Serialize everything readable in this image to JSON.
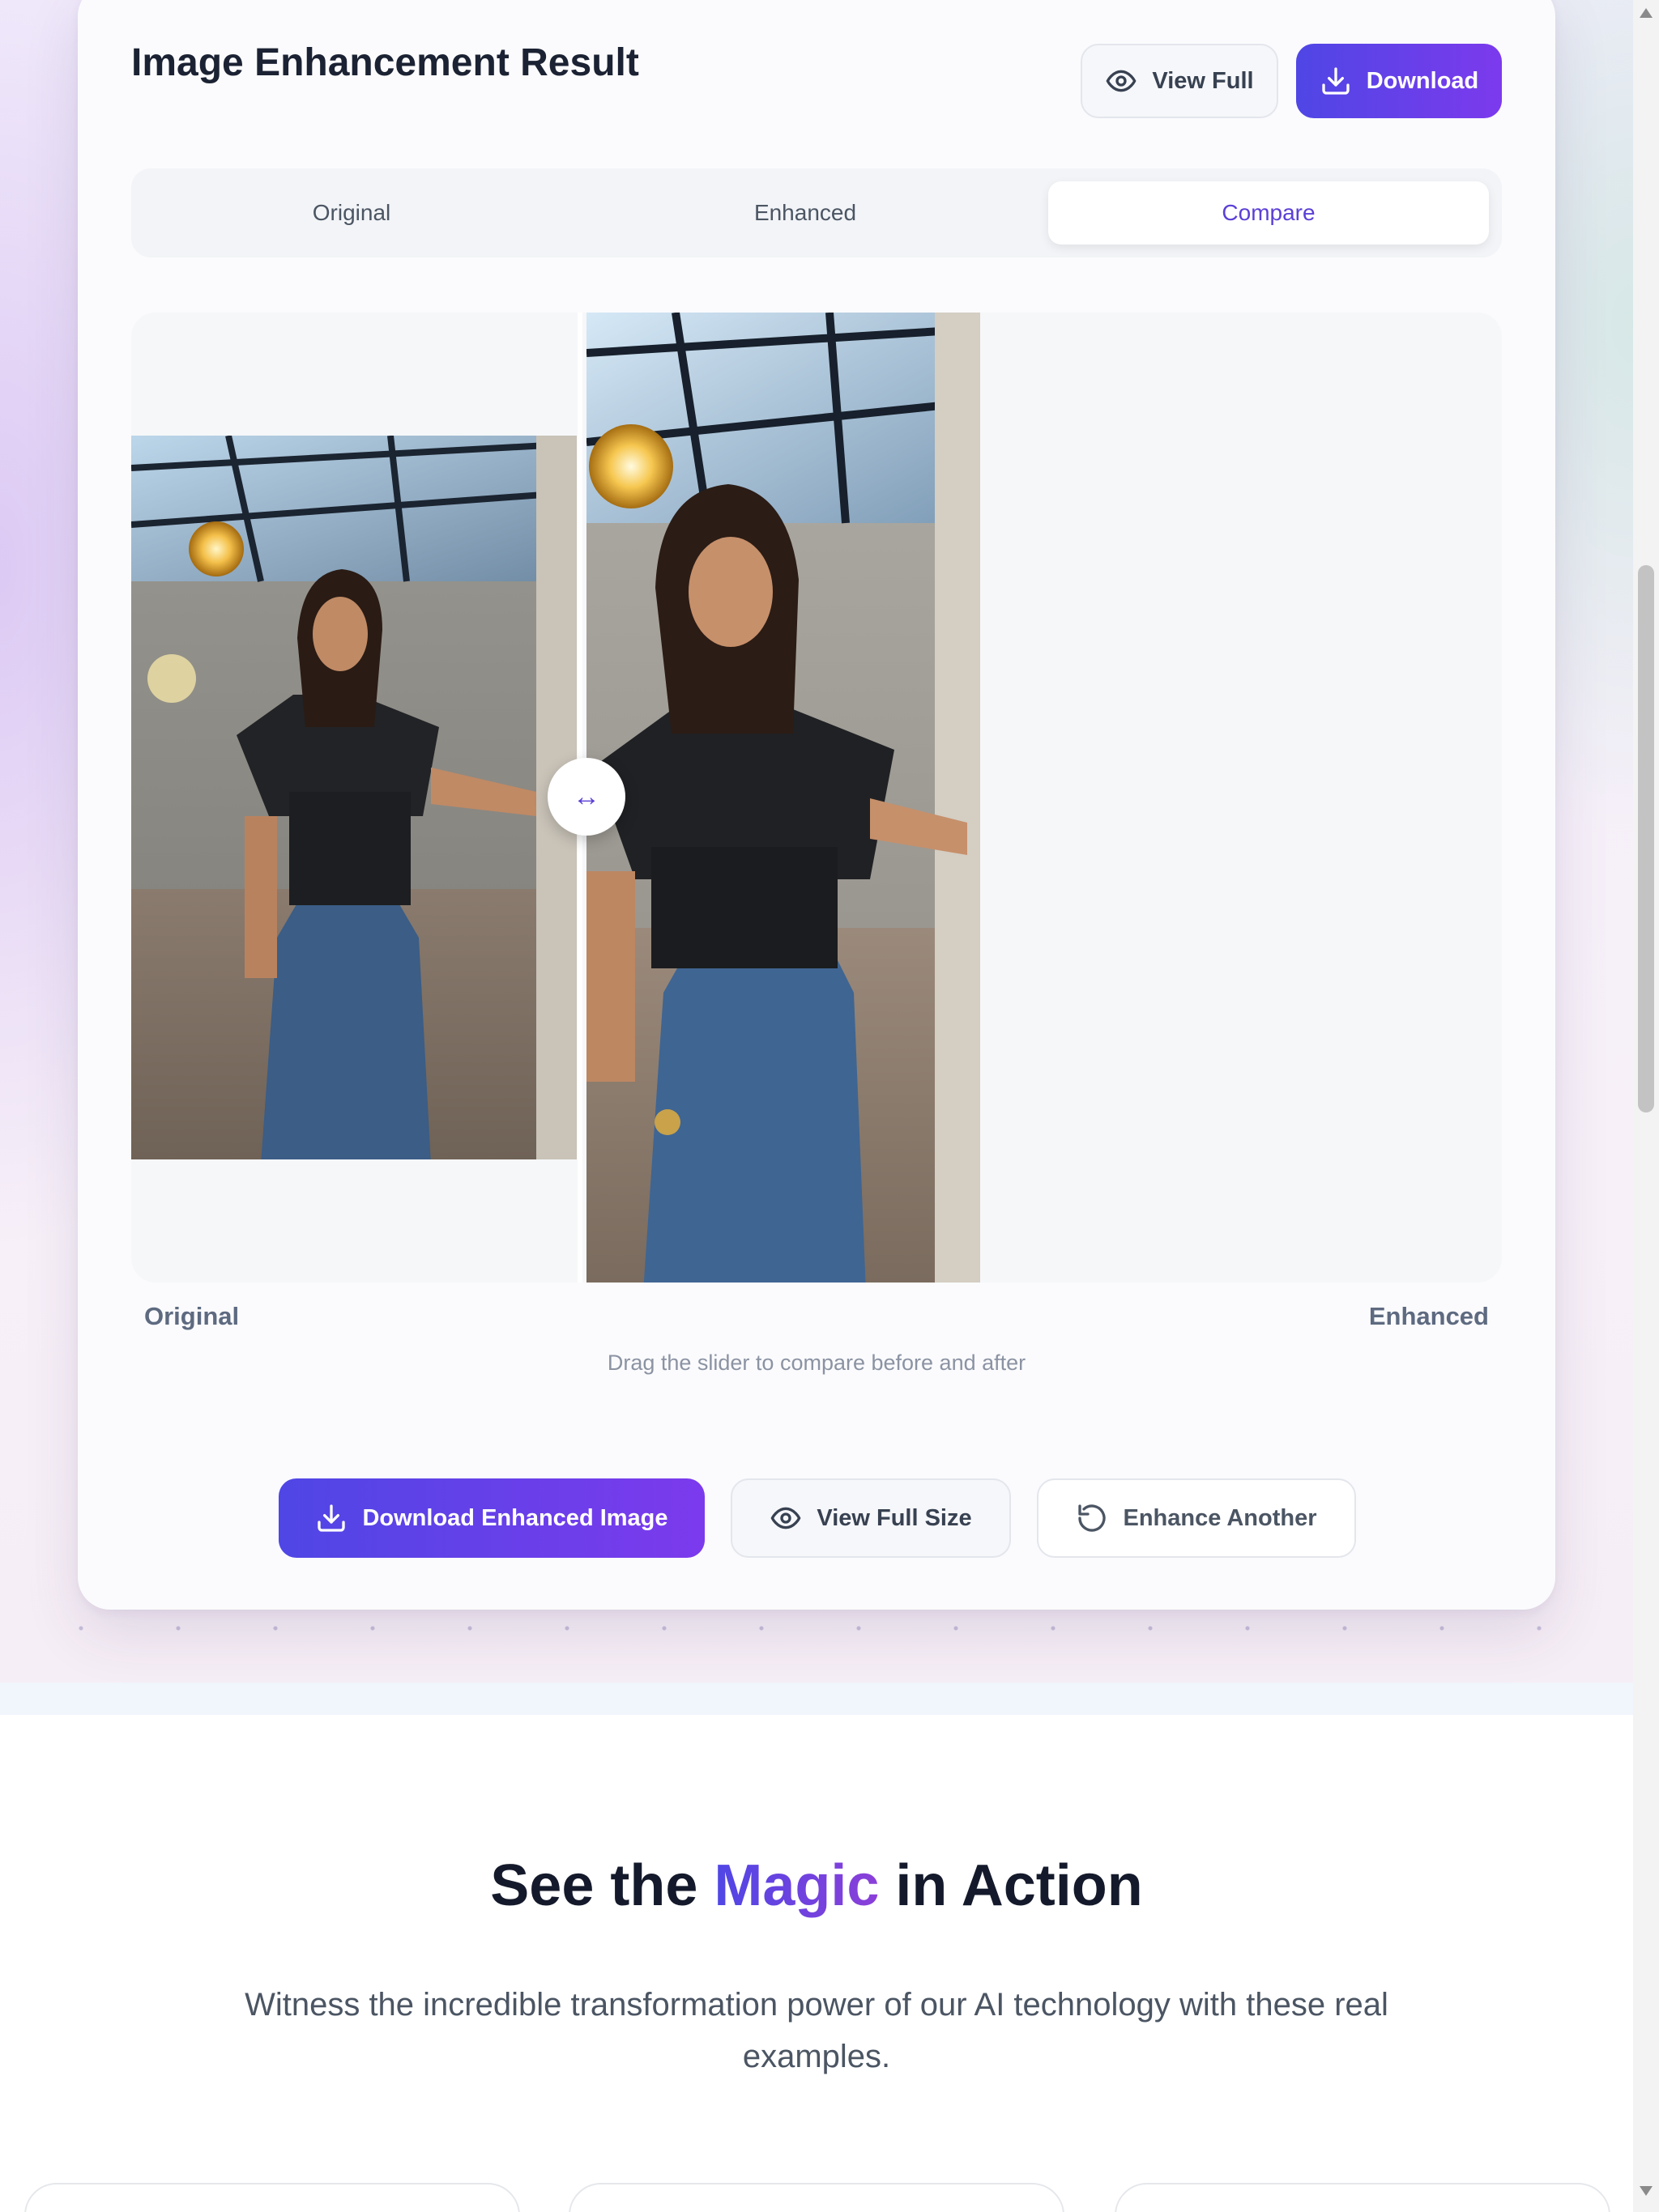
{
  "result_card": {
    "title": "Image Enhancement Result",
    "view_full_label": "View Full",
    "download_label": "Download",
    "tabs": [
      {
        "label": "Original",
        "active": false
      },
      {
        "label": "Enhanced",
        "active": false
      },
      {
        "label": "Compare",
        "active": true
      }
    ],
    "compare": {
      "left_label": "Original",
      "right_label": "Enhanced",
      "hint": "Drag the slider to compare before and after",
      "handle_icon": "↔"
    },
    "actions": {
      "download_enhanced_label": "Download Enhanced Image",
      "view_full_size_label": "View Full Size",
      "enhance_another_label": "Enhance Another"
    }
  },
  "showcase": {
    "title_before": "See the ",
    "title_highlight": "Magic",
    "title_after": " in Action",
    "subtitle": "Witness the incredible transformation power of our AI technology with these real examples."
  },
  "icons": {
    "view": "eye-icon",
    "download": "download-icon",
    "enhance_another": "refresh-icon",
    "slider": "arrows-horizontal-icon"
  },
  "colors": {
    "accent_start": "#4f46e5",
    "accent_end": "#7c3aed",
    "title_text": "#1b2233",
    "active_tab_text": "#5b3fd6"
  }
}
